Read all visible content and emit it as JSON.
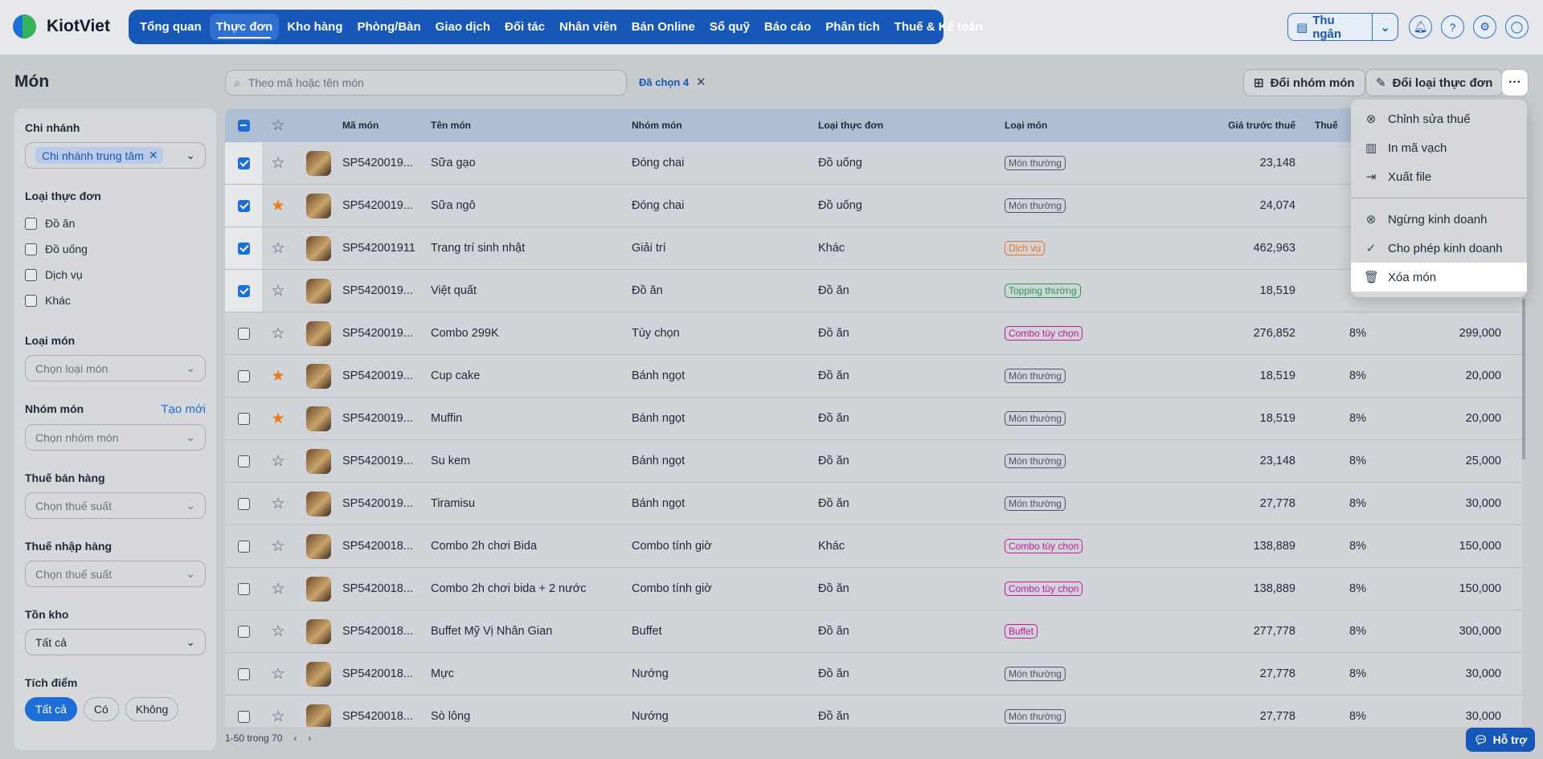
{
  "app": {
    "logo_text": "KiotViet"
  },
  "nav": {
    "items": [
      "Tổng quan",
      "Thực đơn",
      "Kho hàng",
      "Phòng/Bàn",
      "Giao dịch",
      "Đối tác",
      "Nhân viên",
      "Bán Online",
      "Sổ quỹ",
      "Báo cáo",
      "Phân tích",
      "Thuế & Kế toán"
    ],
    "active_index": 1
  },
  "header": {
    "cashier_label": "Thu ngân"
  },
  "page": {
    "title": "Món"
  },
  "filters": {
    "branch": {
      "title": "Chi nhánh",
      "selected": "Chi nhánh trung tâm"
    },
    "menu_type": {
      "title": "Loại thực đơn",
      "options": [
        "Đồ ăn",
        "Đồ uống",
        "Dịch vụ",
        "Khác"
      ]
    },
    "item_type": {
      "title": "Loại món",
      "placeholder": "Chọn loại món"
    },
    "item_group": {
      "title": "Nhóm món",
      "create_link": "Tạo mới",
      "placeholder": "Chọn nhóm món"
    },
    "sales_tax": {
      "title": "Thuế bán hàng",
      "placeholder": "Chọn thuế suất"
    },
    "import_tax": {
      "title": "Thuế nhập hàng",
      "placeholder": "Chọn thuế suất"
    },
    "stock": {
      "title": "Tồn kho",
      "value": "Tất cả"
    },
    "points": {
      "title": "Tích điểm",
      "options": [
        "Tất cả",
        "Có",
        "Không"
      ],
      "active_index": 0
    }
  },
  "toolbar": {
    "search_placeholder": "Theo mã hoặc tên món",
    "selected_label": "Đã chọn 4",
    "change_group_label": "Đổi nhóm món",
    "change_menu_type_label": "Đổi loại thực đơn"
  },
  "table": {
    "headers": {
      "code": "Mã món",
      "name": "Tên món",
      "group": "Nhóm món",
      "menu_type": "Loại thực đơn",
      "item_type": "Loại món",
      "price_before_tax": "Giá trước thuế",
      "tax": "Thuế",
      "sale_price": ""
    },
    "rows": [
      {
        "selected": true,
        "fav": false,
        "code": "SP5420019...",
        "name": "Sữa gạo",
        "group": "Đóng chai",
        "menu_type": "Đồ uống",
        "type": "Món thường",
        "type_color": "#4b5563",
        "price": "23,148",
        "tax": "",
        "sale": ""
      },
      {
        "selected": true,
        "fav": true,
        "code": "SP5420019...",
        "name": "Sữa ngô",
        "group": "Đóng chai",
        "menu_type": "Đồ uống",
        "type": "Món thường",
        "type_color": "#4b5563",
        "price": "24,074",
        "tax": "",
        "sale": ""
      },
      {
        "selected": true,
        "fav": false,
        "code": "SP542001911",
        "name": "Trang trí sinh nhật",
        "group": "Giải trí",
        "menu_type": "Khác",
        "type": "Dịch vụ",
        "type_color": "#e8731e",
        "price": "462,963",
        "tax": "",
        "sale": ""
      },
      {
        "selected": true,
        "fav": false,
        "code": "SP5420019...",
        "name": "Việt quất",
        "group": "Đồ ăn",
        "menu_type": "Đồ ăn",
        "type": "Topping thường",
        "type_color": "#1f9d4c",
        "price": "18,519",
        "tax": "",
        "sale": ""
      },
      {
        "selected": false,
        "fav": false,
        "code": "SP5420019...",
        "name": "Combo 299K",
        "group": "Tùy chọn",
        "menu_type": "Đồ ăn",
        "type": "Combo tùy chọn",
        "type_color": "#c2189a",
        "price": "276,852",
        "tax": "8%",
        "sale": "299,000"
      },
      {
        "selected": false,
        "fav": true,
        "code": "SP5420019...",
        "name": "Cup cake",
        "group": "Bánh ngọt",
        "menu_type": "Đồ ăn",
        "type": "Món thường",
        "type_color": "#4b5563",
        "price": "18,519",
        "tax": "8%",
        "sale": "20,000"
      },
      {
        "selected": false,
        "fav": true,
        "code": "SP5420019...",
        "name": "Muffin",
        "group": "Bánh ngọt",
        "menu_type": "Đồ ăn",
        "type": "Món thường",
        "type_color": "#4b5563",
        "price": "18,519",
        "tax": "8%",
        "sale": "20,000"
      },
      {
        "selected": false,
        "fav": false,
        "code": "SP5420019...",
        "name": "Su kem",
        "group": "Bánh ngọt",
        "menu_type": "Đồ ăn",
        "type": "Món thường",
        "type_color": "#4b5563",
        "price": "23,148",
        "tax": "8%",
        "sale": "25,000"
      },
      {
        "selected": false,
        "fav": false,
        "code": "SP5420019...",
        "name": "Tiramisu",
        "group": "Bánh ngọt",
        "menu_type": "Đồ ăn",
        "type": "Món thường",
        "type_color": "#4b5563",
        "price": "27,778",
        "tax": "8%",
        "sale": "30,000"
      },
      {
        "selected": false,
        "fav": false,
        "code": "SP5420018...",
        "name": "Combo 2h chơi Bida",
        "group": "Combo tính giờ",
        "menu_type": "Khác",
        "type": "Combo tùy chọn",
        "type_color": "#c2189a",
        "price": "138,889",
        "tax": "8%",
        "sale": "150,000"
      },
      {
        "selected": false,
        "fav": false,
        "code": "SP5420018...",
        "name": "Combo 2h chơi bida + 2 nước",
        "group": "Combo tính giờ",
        "menu_type": "Đồ ăn",
        "type": "Combo tùy chọn",
        "type_color": "#c2189a",
        "price": "138,889",
        "tax": "8%",
        "sale": "150,000"
      },
      {
        "selected": false,
        "fav": false,
        "code": "SP5420018...",
        "name": "Buffet Mỹ Vị Nhân Gian",
        "group": "Buffet",
        "menu_type": "Đồ ăn",
        "type": "Buffet",
        "type_color": "#c2189a",
        "price": "277,778",
        "tax": "8%",
        "sale": "300,000"
      },
      {
        "selected": false,
        "fav": false,
        "code": "SP5420018...",
        "name": "Mực",
        "group": "Nướng",
        "menu_type": "Đồ ăn",
        "type": "Món thường",
        "type_color": "#4b5563",
        "price": "27,778",
        "tax": "8%",
        "sale": "30,000"
      },
      {
        "selected": false,
        "fav": false,
        "code": "SP5420018...",
        "name": "Sò lông",
        "group": "Nướng",
        "menu_type": "Đồ ăn",
        "type": "Món thường",
        "type_color": "#4b5563",
        "price": "27,778",
        "tax": "8%",
        "sale": "30,000"
      }
    ]
  },
  "pagination": {
    "label": "1-50 trong 70"
  },
  "help": {
    "label": "Hỗ trợ"
  },
  "actions_menu": {
    "items": [
      {
        "label": "Chỉnh sửa thuế",
        "icon": "tax-edit-icon"
      },
      {
        "label": "In mã vạch",
        "icon": "barcode-icon"
      },
      {
        "label": "Xuất file",
        "icon": "export-icon"
      },
      {
        "label": "Ngừng kinh doanh",
        "icon": "stop-icon"
      },
      {
        "label": "Cho phép kinh doanh",
        "icon": "check-circle-icon"
      },
      {
        "label": "Xóa món",
        "icon": "trash-icon"
      }
    ],
    "highlighted_index": 5
  }
}
